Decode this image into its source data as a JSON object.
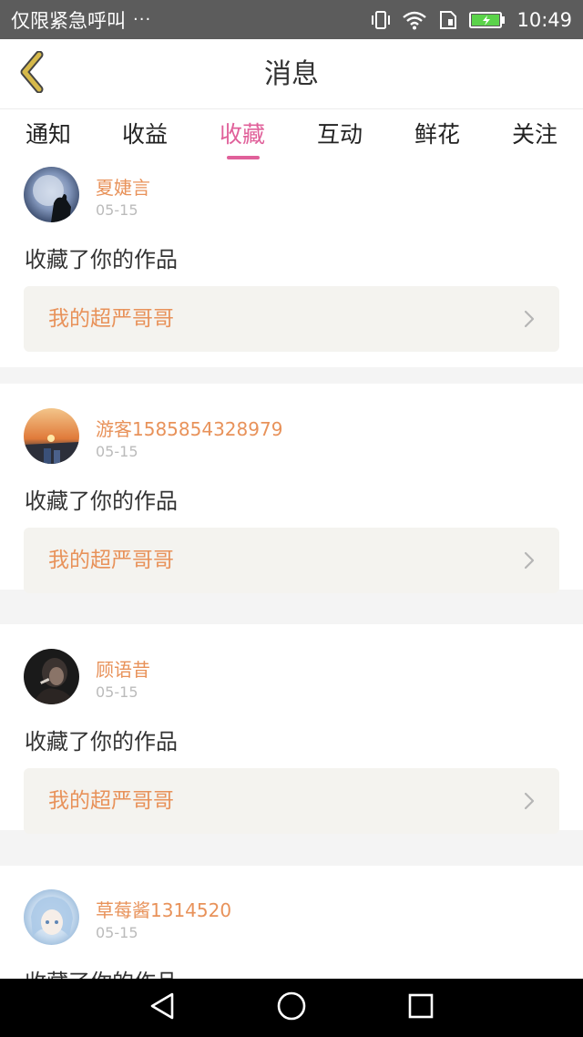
{
  "status_bar": {
    "carrier_text": "仅限紧急呼叫",
    "dots": "···",
    "time": "10:49",
    "icons": [
      "vibrate-icon",
      "wifi-icon",
      "sim-icon",
      "battery-icon"
    ],
    "battery_color": "#5bd34a"
  },
  "header": {
    "title": "消息",
    "back_icon": "chevron-left-icon",
    "back_color": "#d6b94a"
  },
  "tabs": {
    "items": [
      {
        "label": "通知"
      },
      {
        "label": "收益"
      },
      {
        "label": "收藏"
      },
      {
        "label": "互动"
      },
      {
        "label": "鲜花"
      },
      {
        "label": "关注"
      }
    ],
    "active_index": 2,
    "active_color": "#e0609a"
  },
  "feed": {
    "items": [
      {
        "username": "夏婕言",
        "date": "05-15",
        "action": "收藏了你的作品",
        "work_title": "我的超严哥哥",
        "avatar": "moon-silhouette"
      },
      {
        "username": "游客1585854328979",
        "date": "05-15",
        "action": "收藏了你的作品",
        "work_title": "我的超严哥哥",
        "avatar": "sunset"
      },
      {
        "username": "顾语昔",
        "date": "05-15",
        "action": "收藏了你的作品",
        "work_title": "我的超严哥哥",
        "avatar": "dark-portrait"
      },
      {
        "username": "草莓酱1314520",
        "date": "05-15",
        "action": "收藏了你的作品",
        "work_title": "",
        "avatar": "anime-girl"
      }
    ],
    "accent_color": "#e8925a"
  },
  "nav_bar": {
    "buttons": [
      "back-triangle-icon",
      "home-circle-icon",
      "recents-square-icon"
    ]
  }
}
